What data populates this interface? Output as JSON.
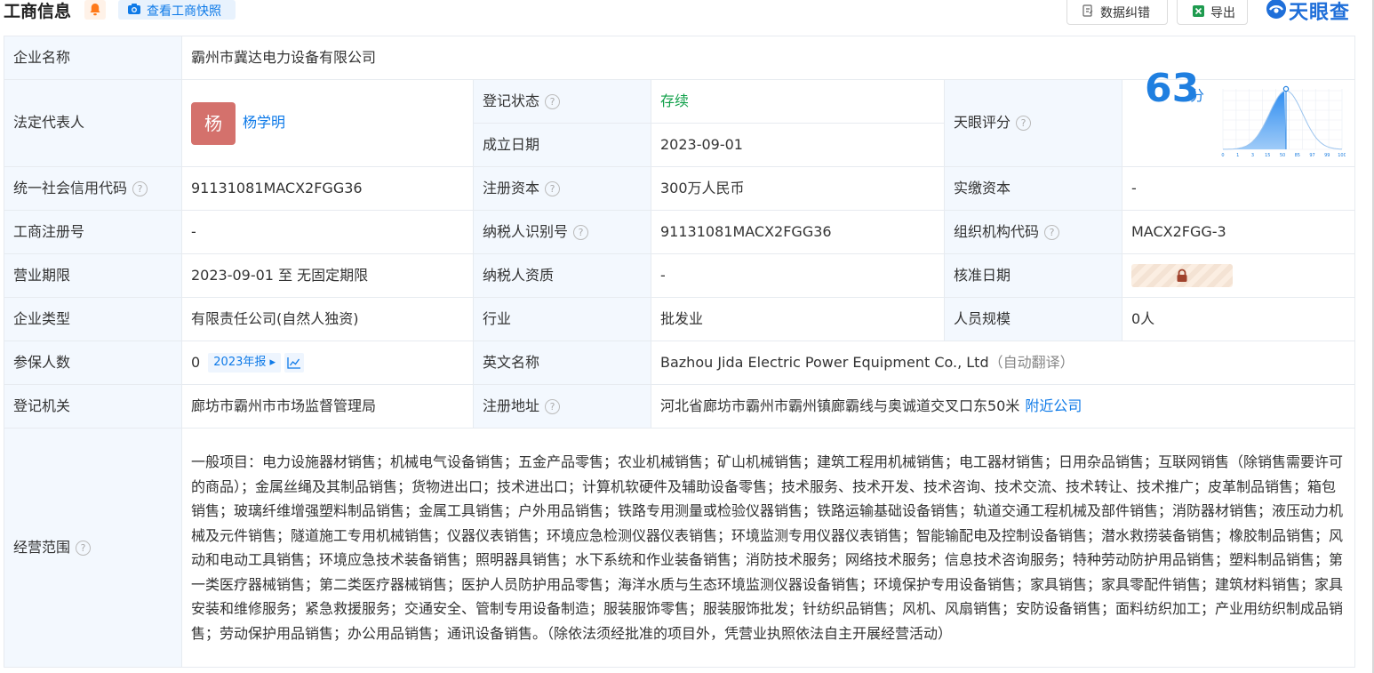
{
  "header": {
    "title": "工商信息",
    "snapshot_label": "查看工商快照",
    "correct_label": "数据纠错",
    "export_label": "导出",
    "brand": "天眼查"
  },
  "company_name_label": "企业名称",
  "company_name": "霸州市冀达电力设备有限公司",
  "legal_rep_label": "法定代表人",
  "legal_rep_avatar": "杨",
  "legal_rep_name": "杨学明",
  "reg_status_label": "登记状态",
  "reg_status": "存续",
  "found_date_label": "成立日期",
  "found_date": "2023-09-01",
  "tianyan_score_label": "天眼评分",
  "score": "63",
  "score_unit": "分",
  "score_chart": {
    "ticks": [
      "0",
      "1",
      "3",
      "15",
      "50",
      "85",
      "97",
      "99",
      "100"
    ],
    "marker_percentile": 50
  },
  "credit_code_label": "统一社会信用代码",
  "credit_code": "91131081MACX2FGG36",
  "reg_capital_label": "注册资本",
  "reg_capital": "300万人民币",
  "paid_capital_label": "实缴资本",
  "paid_capital": "-",
  "biz_reg_no_label": "工商注册号",
  "biz_reg_no": "-",
  "taxpayer_id_label": "纳税人识别号",
  "taxpayer_id": "91131081MACX2FGG36",
  "org_code_label": "组织机构代码",
  "org_code": "MACX2FGG-3",
  "biz_term_label": "营业期限",
  "biz_term": "2023-09-01 至 无固定期限",
  "taxpayer_qual_label": "纳税人资质",
  "taxpayer_qual": "-",
  "approve_date_label": "核准日期",
  "company_type_label": "企业类型",
  "company_type": "有限责任公司(自然人独资)",
  "industry_label": "行业",
  "industry": "批发业",
  "staff_size_label": "人员规模",
  "staff_size": "0人",
  "insured_label": "参保人数",
  "insured_count": "0",
  "insured_report": "2023年报",
  "english_name_label": "英文名称",
  "english_name": "Bazhou Jida Electric Power Equipment Co., Ltd",
  "english_name_note": "（自动翻译）",
  "reg_authority_label": "登记机关",
  "reg_authority": "廊坊市霸州市市场监督管理局",
  "reg_address_label": "注册地址",
  "reg_address": "河北省廊坊市霸州市霸州镇廊霸线与奥诚道交叉口东50米",
  "nearby_link": "附近公司",
  "scope_label": "经营范围",
  "scope": "一般项目：电力设施器材销售；机械电气设备销售；五金产品零售；农业机械销售；矿山机械销售；建筑工程用机械销售；电工器材销售；日用杂品销售；互联网销售（除销售需要许可的商品）；金属丝绳及其制品销售；货物进出口；技术进出口；计算机软硬件及辅助设备零售；技术服务、技术开发、技术咨询、技术交流、技术转让、技术推广；皮革制品销售；箱包销售；玻璃纤维增强塑料制品销售；金属工具销售；户外用品销售；铁路专用测量或检验仪器销售；铁路运输基础设备销售；轨道交通工程机械及部件销售；消防器材销售；液压动力机械及元件销售；隧道施工专用机械销售；仪器仪表销售；环境应急检测仪器仪表销售；环境监测专用仪器仪表销售；智能输配电及控制设备销售；潜水救捞装备销售；橡胶制品销售；风动和电动工具销售；环境应急技术装备销售；照明器具销售；水下系统和作业装备销售；消防技术服务；网络技术服务；信息技术咨询服务；特种劳动防护用品销售；塑料制品销售；第一类医疗器械销售；第二类医疗器械销售；医护人员防护用品零售；海洋水质与生态环境监测仪器设备销售；环境保护专用设备销售；家具销售；家具零配件销售；建筑材料销售；家具安装和维修服务；紧急救援服务；交通安全、管制专用设备制造；服装服饰零售；服装服饰批发；针纺织品销售；风机、风扇销售；安防设备销售；面料纺织加工；产业用纺织制成品销售；劳动保护用品销售；办公用品销售；通讯设备销售。（除依法须经批准的项目外，凭营业执照依法自主开展经营活动）",
  "colors": {
    "accent": "#0e7ae8",
    "label_bg": "#f3f8fe",
    "status_green": "#11a04a",
    "avatar": "#d4716c"
  }
}
